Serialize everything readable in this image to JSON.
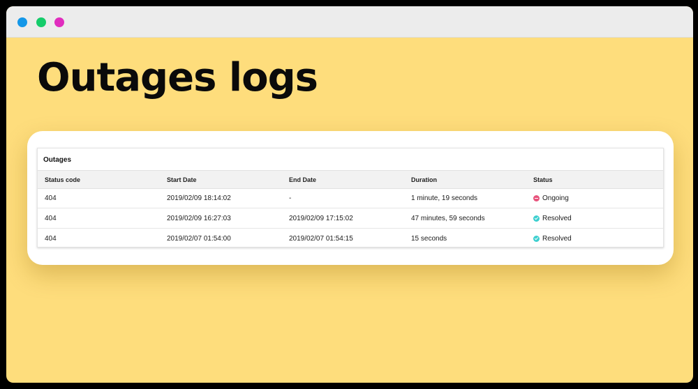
{
  "window": {
    "controls": [
      "blue-dot",
      "green-dot",
      "pink-dot"
    ]
  },
  "page": {
    "title": "Outages logs"
  },
  "outages": {
    "panel_title": "Outages",
    "columns": [
      "Status code",
      "Start Date",
      "End Date",
      "Duration",
      "Status"
    ],
    "rows": [
      {
        "status_code": "404",
        "start_date": "2019/02/09 18:14:02",
        "end_date": "-",
        "duration": "1 minute, 19 seconds",
        "status": "Ongoing",
        "status_icon": "minus-circle-icon",
        "status_color": "#E8537C"
      },
      {
        "status_code": "404",
        "start_date": "2019/02/09 16:27:03",
        "end_date": "2019/02/09 17:15:02",
        "duration": "47 minutes, 59 seconds",
        "status": "Resolved",
        "status_icon": "check-circle-icon",
        "status_color": "#3CCFCF"
      },
      {
        "status_code": "404",
        "start_date": "2019/02/07 01:54:00",
        "end_date": "2019/02/07 01:54:15",
        "duration": "15 seconds",
        "status": "Resolved",
        "status_icon": "check-circle-icon",
        "status_color": "#3CCFCF"
      }
    ]
  },
  "colors": {
    "background": "#FEDD7C",
    "titlebar": "#ECECEC",
    "ongoing": "#E8537C",
    "resolved": "#3CCFCF"
  }
}
